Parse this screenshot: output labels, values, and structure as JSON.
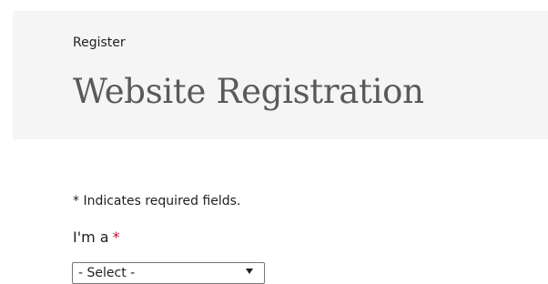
{
  "header": {
    "breadcrumb": "Register",
    "title": "Website Registration"
  },
  "form": {
    "required_note": "* Indicates required fields.",
    "role_field": {
      "label": "I'm a",
      "required_marker": "*",
      "selected_value": "- Select -"
    }
  }
}
